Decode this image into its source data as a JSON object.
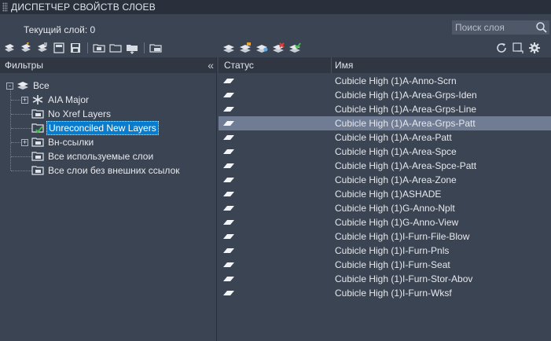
{
  "window": {
    "title": "ДИСПЕТЧЕР СВОЙСТВ СЛОЕВ"
  },
  "current_layer": "Текущий слой: 0",
  "search": {
    "placeholder": "Поиск слоя"
  },
  "filters_panel": {
    "header": "Фильтры",
    "collapse": "«",
    "tree": [
      {
        "label": "Все",
        "icon": "layers-stack-icon",
        "expander": "-"
      },
      {
        "label": "AIA Major",
        "icon": "snowflake-icon",
        "expander": "+"
      },
      {
        "label": "No Xref Layers",
        "icon": "filter-folder-icon"
      },
      {
        "label": "Unreconciled New Layers",
        "icon": "check-folder-icon",
        "selected": true
      },
      {
        "label": "Вн-ссылки",
        "icon": "xref-folder-icon",
        "expander": "+"
      },
      {
        "label": "Все используемые слои",
        "icon": "filter-folder-icon"
      },
      {
        "label": "Все слои без внешних ссылок",
        "icon": "filter-folder-icon"
      }
    ]
  },
  "columns": {
    "status": "Статус",
    "name": "Имя"
  },
  "layers": [
    "Cubicle High (1)A-Anno-Scrn",
    "Cubicle High (1)A-Area-Grps-Iden",
    "Cubicle High (1)A-Area-Grps-Line",
    "Cubicle High (1)A-Area-Grps-Patt",
    "Cubicle High (1)A-Area-Patt",
    "Cubicle High (1)A-Area-Spce",
    "Cubicle High (1)A-Area-Spce-Patt",
    "Cubicle High (1)A-Area-Zone",
    "Cubicle High (1)ASHADE",
    "Cubicle High (1)G-Anno-Nplt",
    "Cubicle High (1)G-Anno-View",
    "Cubicle High (1)I-Furn-File-Blow",
    "Cubicle High (1)I-Furn-Pnls",
    "Cubicle High (1)I-Furn-Seat",
    "Cubicle High (1)I-Furn-Stor-Abov",
    "Cubicle High (1)I-Furn-Wksf"
  ],
  "selected_layer_index": 3,
  "colors": {
    "accent": "#0a7ccd",
    "row_selected": "#6f7c93",
    "background": "#3b4453"
  }
}
